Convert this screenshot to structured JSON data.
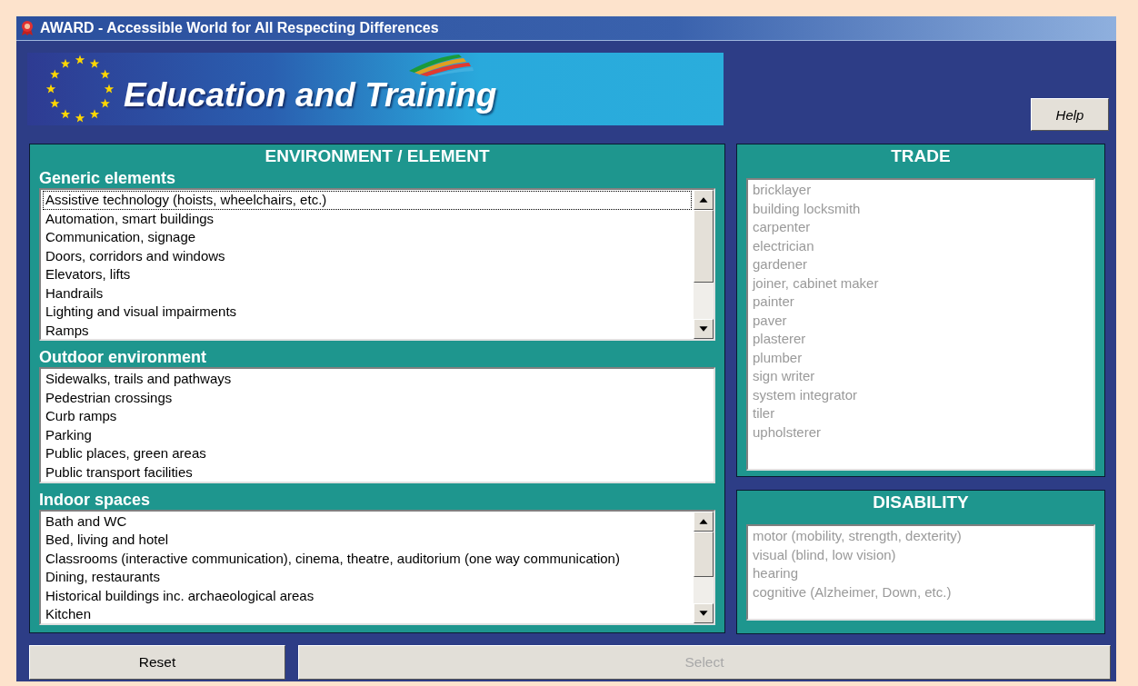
{
  "window": {
    "title": "AWARD - Accessible World for All Respecting Differences"
  },
  "banner": {
    "title": "Education and Training"
  },
  "help_button": {
    "label": "Help"
  },
  "environment": {
    "title": "ENVIRONMENT / ELEMENT",
    "groups": [
      {
        "title": "Generic elements",
        "scrollable": true,
        "items": [
          {
            "label": "Assistive technology (hoists, wheelchairs, etc.)",
            "focused": true
          },
          {
            "label": "Automation, smart buildings",
            "focused": false
          },
          {
            "label": "Communication, signage",
            "focused": false
          },
          {
            "label": "Doors, corridors and windows",
            "focused": false
          },
          {
            "label": "Elevators, lifts",
            "focused": false
          },
          {
            "label": "Handrails",
            "focused": false
          },
          {
            "label": "Lighting and visual impairments",
            "focused": false
          },
          {
            "label": "Ramps",
            "focused": false
          }
        ]
      },
      {
        "title": "Outdoor environment",
        "scrollable": false,
        "items": [
          {
            "label": "Sidewalks, trails and pathways",
            "focused": false
          },
          {
            "label": "Pedestrian crossings",
            "focused": false
          },
          {
            "label": "Curb ramps",
            "focused": false
          },
          {
            "label": "Parking",
            "focused": false
          },
          {
            "label": "Public places, green areas",
            "focused": false
          },
          {
            "label": "Public transport facilities",
            "focused": false
          }
        ]
      },
      {
        "title": "Indoor spaces",
        "scrollable": true,
        "items": [
          {
            "label": "Bath and WC",
            "focused": false
          },
          {
            "label": "Bed, living and hotel",
            "focused": false
          },
          {
            "label": "Classrooms (interactive communication), cinema, theatre, auditorium (one way communication)",
            "focused": false
          },
          {
            "label": "Dining, restaurants",
            "focused": false
          },
          {
            "label": "Historical buildings inc. archaeological areas",
            "focused": false
          },
          {
            "label": "Kitchen",
            "focused": false
          }
        ]
      }
    ]
  },
  "trade": {
    "title": "TRADE",
    "disabled": true,
    "items": [
      "bricklayer",
      "building locksmith",
      "carpenter",
      "electrician",
      "gardener",
      "joiner, cabinet maker",
      "painter",
      "paver",
      "plasterer",
      "plumber",
      "sign writer",
      "system integrator",
      "tiler",
      "upholsterer"
    ]
  },
  "disability": {
    "title": "DISABILITY",
    "disabled": true,
    "items": [
      "motor (mobility, strength, dexterity)",
      "visual (blind, low vision)",
      "hearing",
      "cognitive (Alzheimer, Down, etc.)"
    ]
  },
  "buttons": [
    {
      "label": "Reset",
      "disabled": false
    },
    {
      "label": "Select",
      "disabled": true
    }
  ]
}
